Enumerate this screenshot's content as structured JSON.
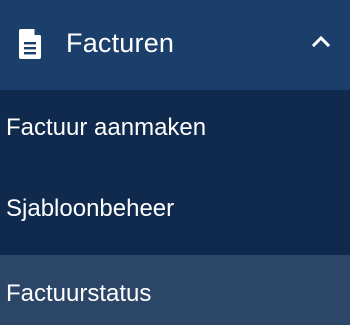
{
  "menu": {
    "header": {
      "label": "Facturen",
      "icon": "document-icon",
      "toggle_icon": "chevron-up-icon",
      "expanded": true
    },
    "items": [
      {
        "label": "Factuur aanmaken"
      },
      {
        "label": "Sjabloonbeheer"
      },
      {
        "label": "Factuurstatus",
        "highlighted": true
      }
    ]
  },
  "colors": {
    "header_background": "#1c3e6b",
    "submenu_background": "#0f2a4c",
    "highlight_background": "#2c4668",
    "text": "#ffffff"
  }
}
